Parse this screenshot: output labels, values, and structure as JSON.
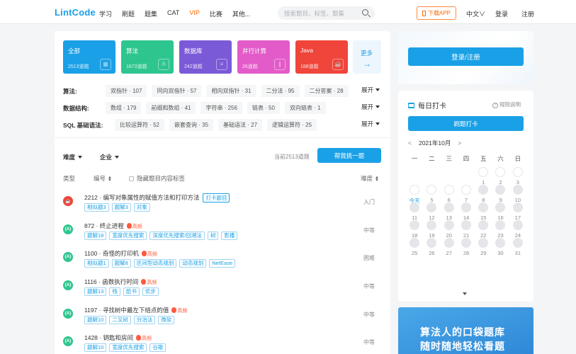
{
  "nav": {
    "logo": "LintCode",
    "links": [
      "学习",
      "刷题",
      "题集",
      "CAT",
      "VIP",
      "比赛",
      "其他..."
    ],
    "search_placeholder": "搜索题目、标签、题集",
    "app_button": "下载APP",
    "lang": "中文∨",
    "login": "登录",
    "register": "注册"
  },
  "categories": [
    {
      "title": "全部",
      "count": "2513道题",
      "color": "#1aa0e6",
      "icon": "grid-icon"
    },
    {
      "title": "算法",
      "count": "1673道题",
      "color": "#2ec58e",
      "icon": "algorithm-icon"
    },
    {
      "title": "数据库",
      "count": "242道题",
      "color": "#7b5ad8",
      "icon": "database-icon"
    },
    {
      "title": "并行计算",
      "count": "26道题",
      "color": "#e35bc8",
      "icon": "parallel-icon"
    },
    {
      "title": "Java",
      "count": "188道题",
      "color": "#f0453a",
      "icon": "java-icon"
    }
  ],
  "more": "更多",
  "tag_rows": [
    {
      "label": "算法:",
      "tags": [
        "双指针 · 107",
        "同向双指针 · 57",
        "相向双指针 · 31",
        "二分法 · 95",
        "二分答案 · 28"
      ]
    },
    {
      "label": "数据结构:",
      "tags": [
        "数组 · 179",
        "前缀和数组 · 41",
        "字符串 · 256",
        "链表 · 50",
        "双向链表 · 1"
      ]
    },
    {
      "label": "SQL 基础语法:",
      "tags": [
        "比较运算符 · 52",
        "嵌套查询 · 35",
        "基础语法 · 27",
        "逻辑运算符 · 25"
      ]
    }
  ],
  "expand": "展开",
  "filters": {
    "difficulty": "难度",
    "company": "企业"
  },
  "current_count": "当前2513道题",
  "pick_button": "帮我挑一题",
  "table_header": {
    "type": "类型",
    "number": "编号",
    "hide_tags": "隐藏题目内容标签",
    "difficulty": "难度"
  },
  "problems": [
    {
      "badge": "Java",
      "badge_color": "#f0453a",
      "title": "2212 · 编写对象属性的赋值方法和打印方法",
      "hot": "",
      "daily": "打卡题目",
      "tags": [
        "相似题3",
        "题解3",
        "对象"
      ],
      "difficulty": "入门"
    },
    {
      "badge": "{A}",
      "badge_color": "#2ec58e",
      "title": "872 · 终止进程",
      "hot": "高频",
      "daily": "",
      "tags": [
        "题解18",
        "宽度优先搜索",
        "深度优先搜索/回溯法",
        "树",
        "影播"
      ],
      "difficulty": "中等"
    },
    {
      "badge": "{A}",
      "badge_color": "#2ec58e",
      "title": "1100 · 奇怪的打印机",
      "hot": "高频",
      "daily": "",
      "tags": [
        "相似题1",
        "题解8",
        "区间型动态规划",
        "动态规划",
        "NetEase"
      ],
      "difficulty": "困难"
    },
    {
      "badge": "{A}",
      "badge_color": "#2ec58e",
      "title": "1116 · 函数执行时间",
      "hot": "高频",
      "daily": "",
      "tags": [
        "题解13",
        "栈",
        "脸书",
        "优步"
      ],
      "difficulty": "中等"
    },
    {
      "badge": "{A}",
      "badge_color": "#2ec58e",
      "title": "1197 · 寻找树中最左下结点的值",
      "hot": "高频",
      "daily": "",
      "tags": [
        "题解10",
        "二叉树",
        "分治法",
        "微软"
      ],
      "difficulty": "中等"
    },
    {
      "badge": "{A}",
      "badge_color": "#2ec58e",
      "title": "1428 · 钥匙和房间",
      "hot": "高频",
      "daily": "",
      "tags": [
        "题解10",
        "宽度优先搜索",
        "谷歌"
      ],
      "difficulty": "中等"
    }
  ],
  "login_box": {
    "button": "登录/注册"
  },
  "checkin": {
    "title": "每日打卡",
    "rules": "规则说明",
    "button": "刷题打卡",
    "month": "2021年10月",
    "weekdays": [
      "一",
      "二",
      "三",
      "四",
      "五",
      "六",
      "日"
    ],
    "today_label": "今天",
    "weeks": [
      [
        "",
        "",
        "",
        "",
        "1",
        "2",
        "3"
      ],
      [
        "今天",
        "5",
        "6",
        "7",
        "8",
        "9",
        "10"
      ],
      [
        "11",
        "12",
        "13",
        "14",
        "15",
        "16",
        "17"
      ],
      [
        "18",
        "19",
        "20",
        "21",
        "22",
        "23",
        "24"
      ],
      [
        "25",
        "26",
        "27",
        "28",
        "29",
        "30",
        "31"
      ]
    ]
  },
  "banner": {
    "line1": "算法人的口袋题库",
    "line2": "随时随地轻松看题"
  }
}
